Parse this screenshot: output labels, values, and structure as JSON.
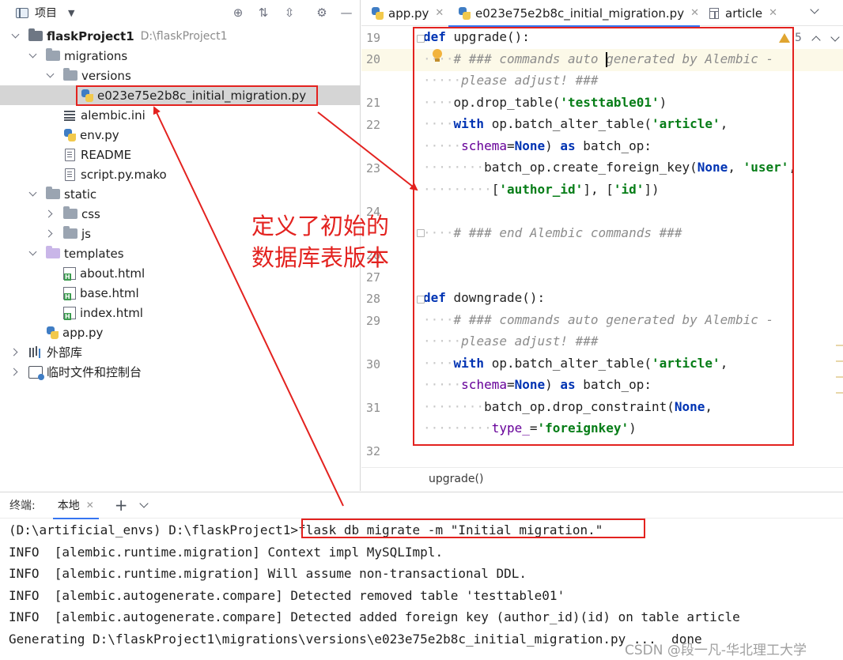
{
  "project_panel": {
    "title": "项目",
    "tree": [
      {
        "label": "flaskProject1",
        "hint": "D:\\flaskProject1",
        "icon": "folder-icon",
        "chevron": "down",
        "depth": 0
      },
      {
        "label": "migrations",
        "icon": "folder-icon",
        "chevron": "down",
        "depth": 1
      },
      {
        "label": "versions",
        "icon": "folder-icon",
        "chevron": "down",
        "depth": 2
      },
      {
        "label": "e023e75e2b8c_initial_migration.py",
        "icon": "python-file-icon",
        "chevron": "none",
        "depth": 3,
        "selected": true
      },
      {
        "label": "alembic.ini",
        "icon": "ini-file-icon",
        "chevron": "none",
        "depth": 2
      },
      {
        "label": "env.py",
        "icon": "python-file-icon",
        "chevron": "none",
        "depth": 2
      },
      {
        "label": "README",
        "icon": "text-file-icon",
        "chevron": "none",
        "depth": 2
      },
      {
        "label": "script.py.mako",
        "icon": "text-file-icon",
        "chevron": "none",
        "depth": 2
      },
      {
        "label": "static",
        "icon": "folder-icon",
        "chevron": "down",
        "depth": 1
      },
      {
        "label": "css",
        "icon": "folder-icon",
        "chevron": "right",
        "depth": 2
      },
      {
        "label": "js",
        "icon": "folder-icon",
        "chevron": "right",
        "depth": 2
      },
      {
        "label": "templates",
        "icon": "folder-icon-purple",
        "chevron": "down",
        "depth": 1
      },
      {
        "label": "about.html",
        "icon": "html-file-icon",
        "chevron": "none",
        "depth": 2
      },
      {
        "label": "base.html",
        "icon": "html-file-icon",
        "chevron": "none",
        "depth": 2
      },
      {
        "label": "index.html",
        "icon": "html-file-icon",
        "chevron": "none",
        "depth": 2
      },
      {
        "label": "app.py",
        "icon": "python-file-icon",
        "chevron": "none",
        "depth": 1
      },
      {
        "label": "外部库",
        "icon": "library-icon",
        "chevron": "right",
        "depth": 0
      },
      {
        "label": "临时文件和控制台",
        "icon": "scratch-icon",
        "chevron": "right",
        "depth": 0
      }
    ]
  },
  "editor": {
    "tabs": [
      {
        "label": "app.py",
        "icon": "python-file-icon",
        "active": false
      },
      {
        "label": "e023e75e2b8c_initial_migration.py",
        "icon": "python-file-icon",
        "active": true
      },
      {
        "label": "article",
        "icon": "table-icon",
        "active": false
      }
    ],
    "warning_count": "5",
    "line_numbers": [
      "19",
      "20",
      "21",
      "22",
      "23",
      "24",
      "26",
      "27",
      "28",
      "29",
      "30",
      "31",
      "32"
    ],
    "code": {
      "l19": {
        "kw": "def",
        "rest": " upgrade():"
      },
      "l20": {
        "comment": "# ### commands auto generated by Alembic -"
      },
      "l20b": {
        "comment": "please adjust! ###"
      },
      "l21": {
        "a": "op.drop_table(",
        "s": "'testtable01'",
        "b": ")"
      },
      "l22": {
        "kw": "with",
        "a": " op.batch_alter_table(",
        "s": "'article'",
        "b": ","
      },
      "l22b": {
        "kw1": "schema",
        "a": "=",
        "kw2": "None",
        "b": ") ",
        "kw3": "as",
        "c": " batch_op:"
      },
      "l23": {
        "a": "batch_op.create_foreign_key(",
        "kw": "None",
        "b": ", ",
        "s": "'user'",
        "c": ","
      },
      "l23b": {
        "a": "[",
        "s1": "'author_id'",
        "b": "], [",
        "s2": "'id'",
        "c": "])"
      },
      "l24": {
        "comment": "# ### end Alembic commands ###"
      },
      "l28": {
        "kw": "def",
        "rest": " downgrade():"
      },
      "l29": {
        "comment": "# ### commands auto generated by Alembic -"
      },
      "l29b": {
        "comment": "please adjust! ###"
      },
      "l30": {
        "kw": "with",
        "a": " op.batch_alter_table(",
        "s": "'article'",
        "b": ","
      },
      "l30b": {
        "kw1": "schema",
        "a": "=",
        "kw2": "None",
        "b": ") ",
        "kw3": "as",
        "c": " batch_op:"
      },
      "l31": {
        "a": "batch_op.drop_constraint(",
        "kw": "None",
        "b": ","
      },
      "l31b": {
        "kw1": "type_",
        "a": "=",
        "s": "'foreignkey'",
        "b": ")"
      }
    },
    "breadcrumb": "upgrade()"
  },
  "terminal": {
    "label": "终端:",
    "tab": "本地",
    "prompt": "(D:\\artificial_envs) D:\\flaskProject1>",
    "command": "flask db migrate -m \"Initial migration.\"",
    "output": [
      "INFO  [alembic.runtime.migration] Context impl MySQLImpl.",
      "INFO  [alembic.runtime.migration] Will assume non-transactional DDL.",
      "INFO  [alembic.autogenerate.compare] Detected removed table 'testtable01'",
      "INFO  [alembic.autogenerate.compare] Detected added foreign key (author_id)(id) on table article",
      "Generating D:\\flaskProject1\\migrations\\versions\\e023e75e2b8c_initial_migration.py ...  done"
    ]
  },
  "annotation": {
    "text_line1": "定义了初始的",
    "text_line2": "数据库表版本",
    "color": "#e3221f"
  },
  "watermark": "CSDN @段一凡-华北理工大学"
}
